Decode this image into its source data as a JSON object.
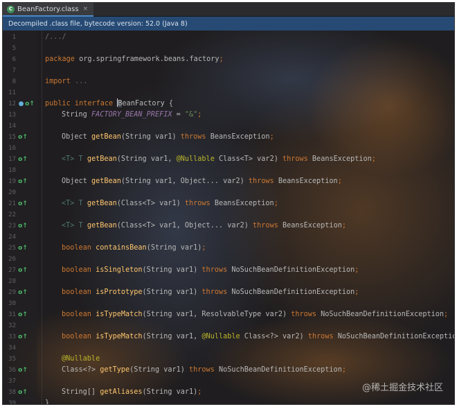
{
  "tab": {
    "name": "BeanFactory.class",
    "icon": "class-file-icon",
    "close_glyph": "×",
    "icon_glyph": "C"
  },
  "banner": {
    "text": "Decompiled .class file, bytecode version: 52.0 (Java 8)"
  },
  "watermark": "@稀土掘金技术社区",
  "gutter_icons": {
    "override": "override-method-icon",
    "implemented": "implemented-icon"
  },
  "colors": {
    "keyword": "#cc7832",
    "method": "#ffc66d",
    "annotation": "#bbb529",
    "constant": "#9876aa",
    "string": "#6a8759",
    "banner_bg": "#264a74"
  },
  "lines": [
    {
      "no": "1",
      "parts": [
        {
          "t": "/.../",
          "c": "cmt"
        }
      ]
    },
    {
      "no": "5",
      "parts": []
    },
    {
      "no": "6",
      "parts": [
        {
          "t": "package ",
          "c": "kw"
        },
        {
          "t": "org.springframework.beans.factory",
          "c": ""
        },
        {
          "t": ";",
          "c": "kw"
        }
      ]
    },
    {
      "no": "7",
      "parts": []
    },
    {
      "no": "8",
      "parts": [
        {
          "t": "import ",
          "c": "kw"
        },
        {
          "t": "...",
          "c": "cmt"
        }
      ]
    },
    {
      "no": "11",
      "parts": []
    },
    {
      "no": "12",
      "icons": [
        "implemented",
        "override"
      ],
      "parts": [
        {
          "t": "public interface ",
          "c": "kw"
        },
        {
          "t": "B",
          "c": "caret"
        },
        {
          "t": "eanFactory {",
          "c": ""
        }
      ]
    },
    {
      "no": "13",
      "indent": 1,
      "parts": [
        {
          "t": "String ",
          "c": ""
        },
        {
          "t": "FACTORY_BEAN_PREFIX",
          "c": "const"
        },
        {
          "t": " = ",
          "c": ""
        },
        {
          "t": "\"&\"",
          "c": "str"
        },
        {
          "t": ";",
          "c": "kw"
        }
      ]
    },
    {
      "no": "14",
      "parts": []
    },
    {
      "no": "15",
      "indent": 1,
      "icons": [
        "override"
      ],
      "parts": [
        {
          "t": "Object ",
          "c": ""
        },
        {
          "t": "getBean",
          "c": "fn"
        },
        {
          "t": "(String var1) ",
          "c": ""
        },
        {
          "t": "throws ",
          "c": "kw"
        },
        {
          "t": "BeansException",
          "c": ""
        },
        {
          "t": ";",
          "c": "kw"
        }
      ]
    },
    {
      "no": "16",
      "parts": []
    },
    {
      "no": "17",
      "indent": 1,
      "icons": [
        "override"
      ],
      "parts": [
        {
          "t": "<T> T ",
          "c": "tp"
        },
        {
          "t": "getBean",
          "c": "fn"
        },
        {
          "t": "(String var1, ",
          "c": ""
        },
        {
          "t": "@Nullable ",
          "c": "ann"
        },
        {
          "t": "Class<T> var2) ",
          "c": ""
        },
        {
          "t": "throws ",
          "c": "kw"
        },
        {
          "t": "BeansException",
          "c": ""
        },
        {
          "t": ";",
          "c": "kw"
        }
      ]
    },
    {
      "no": "18",
      "parts": []
    },
    {
      "no": "19",
      "indent": 1,
      "icons": [
        "override"
      ],
      "parts": [
        {
          "t": "Object ",
          "c": ""
        },
        {
          "t": "getBean",
          "c": "fn"
        },
        {
          "t": "(String var1, Object... var2) ",
          "c": ""
        },
        {
          "t": "throws ",
          "c": "kw"
        },
        {
          "t": "BeansException",
          "c": ""
        },
        {
          "t": ";",
          "c": "kw"
        }
      ]
    },
    {
      "no": "20",
      "parts": []
    },
    {
      "no": "21",
      "indent": 1,
      "icons": [
        "override"
      ],
      "parts": [
        {
          "t": "<T> T ",
          "c": "tp"
        },
        {
          "t": "getBean",
          "c": "fn"
        },
        {
          "t": "(Class<T> var1) ",
          "c": ""
        },
        {
          "t": "throws ",
          "c": "kw"
        },
        {
          "t": "BeansException",
          "c": ""
        },
        {
          "t": ";",
          "c": "kw"
        }
      ]
    },
    {
      "no": "22",
      "parts": []
    },
    {
      "no": "23",
      "indent": 1,
      "icons": [
        "override"
      ],
      "parts": [
        {
          "t": "<T> T ",
          "c": "tp"
        },
        {
          "t": "getBean",
          "c": "fn"
        },
        {
          "t": "(Class<T> var1, Object... var2) ",
          "c": ""
        },
        {
          "t": "throws ",
          "c": "kw"
        },
        {
          "t": "BeansException",
          "c": ""
        },
        {
          "t": ";",
          "c": "kw"
        }
      ]
    },
    {
      "no": "24",
      "parts": []
    },
    {
      "no": "25",
      "indent": 1,
      "icons": [
        "override"
      ],
      "parts": [
        {
          "t": "boolean ",
          "c": "kw"
        },
        {
          "t": "containsBean",
          "c": "fn"
        },
        {
          "t": "(String var1)",
          "c": ""
        },
        {
          "t": ";",
          "c": "kw"
        }
      ]
    },
    {
      "no": "26",
      "parts": []
    },
    {
      "no": "27",
      "indent": 1,
      "icons": [
        "override"
      ],
      "parts": [
        {
          "t": "boolean ",
          "c": "kw"
        },
        {
          "t": "isSingleton",
          "c": "fn"
        },
        {
          "t": "(String var1) ",
          "c": ""
        },
        {
          "t": "throws ",
          "c": "kw"
        },
        {
          "t": "NoSuchBeanDefinitionException",
          "c": ""
        },
        {
          "t": ";",
          "c": "kw"
        }
      ]
    },
    {
      "no": "28",
      "parts": []
    },
    {
      "no": "29",
      "indent": 1,
      "icons": [
        "override"
      ],
      "parts": [
        {
          "t": "boolean ",
          "c": "kw"
        },
        {
          "t": "isPrototype",
          "c": "fn"
        },
        {
          "t": "(String var1) ",
          "c": ""
        },
        {
          "t": "throws ",
          "c": "kw"
        },
        {
          "t": "NoSuchBeanDefinitionException",
          "c": ""
        },
        {
          "t": ";",
          "c": "kw"
        }
      ]
    },
    {
      "no": "30",
      "parts": []
    },
    {
      "no": "31",
      "indent": 1,
      "icons": [
        "override"
      ],
      "parts": [
        {
          "t": "boolean ",
          "c": "kw"
        },
        {
          "t": "isTypeMatch",
          "c": "fn"
        },
        {
          "t": "(String var1, ResolvableType var2) ",
          "c": ""
        },
        {
          "t": "throws ",
          "c": "kw"
        },
        {
          "t": "NoSuchBeanDefinitionException",
          "c": ""
        },
        {
          "t": ";",
          "c": "kw"
        }
      ]
    },
    {
      "no": "32",
      "parts": []
    },
    {
      "no": "33",
      "indent": 1,
      "icons": [
        "override"
      ],
      "parts": [
        {
          "t": "boolean ",
          "c": "kw"
        },
        {
          "t": "isTypeMatch",
          "c": "fn"
        },
        {
          "t": "(String var1, ",
          "c": ""
        },
        {
          "t": "@Nullable ",
          "c": "ann"
        },
        {
          "t": "Class<?> var2) ",
          "c": ""
        },
        {
          "t": "throws ",
          "c": "kw"
        },
        {
          "t": "NoSuchBeanDefinitionException",
          "c": ""
        },
        {
          "t": ";",
          "c": "kw"
        }
      ]
    },
    {
      "no": "34",
      "parts": []
    },
    {
      "no": "35",
      "indent": 1,
      "parts": [
        {
          "t": "@Nullable",
          "c": "ann"
        }
      ]
    },
    {
      "no": "36",
      "indent": 1,
      "icons": [
        "override"
      ],
      "parts": [
        {
          "t": "Class<?> ",
          "c": ""
        },
        {
          "t": "getType",
          "c": "fn"
        },
        {
          "t": "(String var1) ",
          "c": ""
        },
        {
          "t": "throws ",
          "c": "kw"
        },
        {
          "t": "NoSuchBeanDefinitionException",
          "c": ""
        },
        {
          "t": ";",
          "c": "kw"
        }
      ]
    },
    {
      "no": "37",
      "parts": []
    },
    {
      "no": "38",
      "indent": 1,
      "icons": [
        "override"
      ],
      "parts": [
        {
          "t": "String[] ",
          "c": ""
        },
        {
          "t": "getAliases",
          "c": "fn"
        },
        {
          "t": "(String var1)",
          "c": ""
        },
        {
          "t": ";",
          "c": "kw"
        }
      ]
    },
    {
      "no": "39",
      "parts": [
        {
          "t": "}",
          "c": ""
        }
      ]
    }
  ]
}
